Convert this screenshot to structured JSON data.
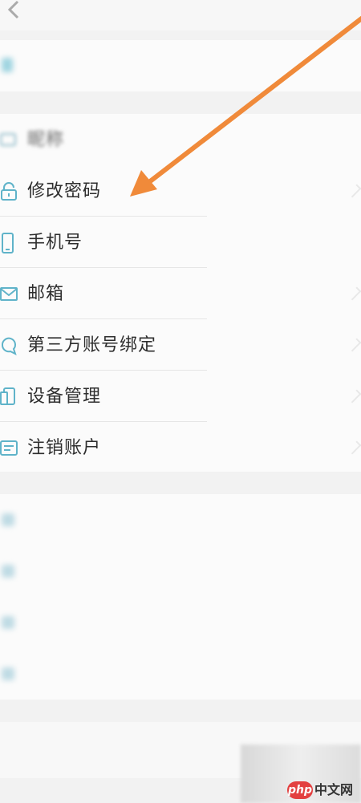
{
  "header": {
    "title": "",
    "back_icon": "back-chevron-icon"
  },
  "sections": {
    "top": [
      {
        "label": "",
        "value": "",
        "icon": "user-icon"
      }
    ],
    "account": [
      {
        "label": "昵称",
        "value": "",
        "icon": "card-icon"
      },
      {
        "label": "修改密码",
        "value": "",
        "icon": "lock-icon"
      },
      {
        "label": "手机号",
        "value": "",
        "icon": "phone-icon"
      },
      {
        "label": "邮箱",
        "value": "",
        "icon": "mail-icon"
      },
      {
        "label": "第三方账号绑定",
        "value": "",
        "icon": "bubble-icon"
      },
      {
        "label": "设备管理",
        "value": "",
        "icon": "device-icon"
      },
      {
        "label": "注销账户",
        "value": "",
        "icon": "id-card-icon"
      }
    ],
    "other": [
      {
        "label": "",
        "icon": "item-icon"
      },
      {
        "label": "",
        "icon": "item-icon"
      },
      {
        "label": "",
        "icon": "item-icon"
      },
      {
        "label": "",
        "icon": "item-icon"
      }
    ]
  },
  "logout": {
    "label": ""
  },
  "watermark": {
    "badge": "php",
    "text": "中文网"
  },
  "colors": {
    "arrow": "#f08a3a",
    "icon": "#5fb3c9",
    "logout_text": "#e05555"
  }
}
